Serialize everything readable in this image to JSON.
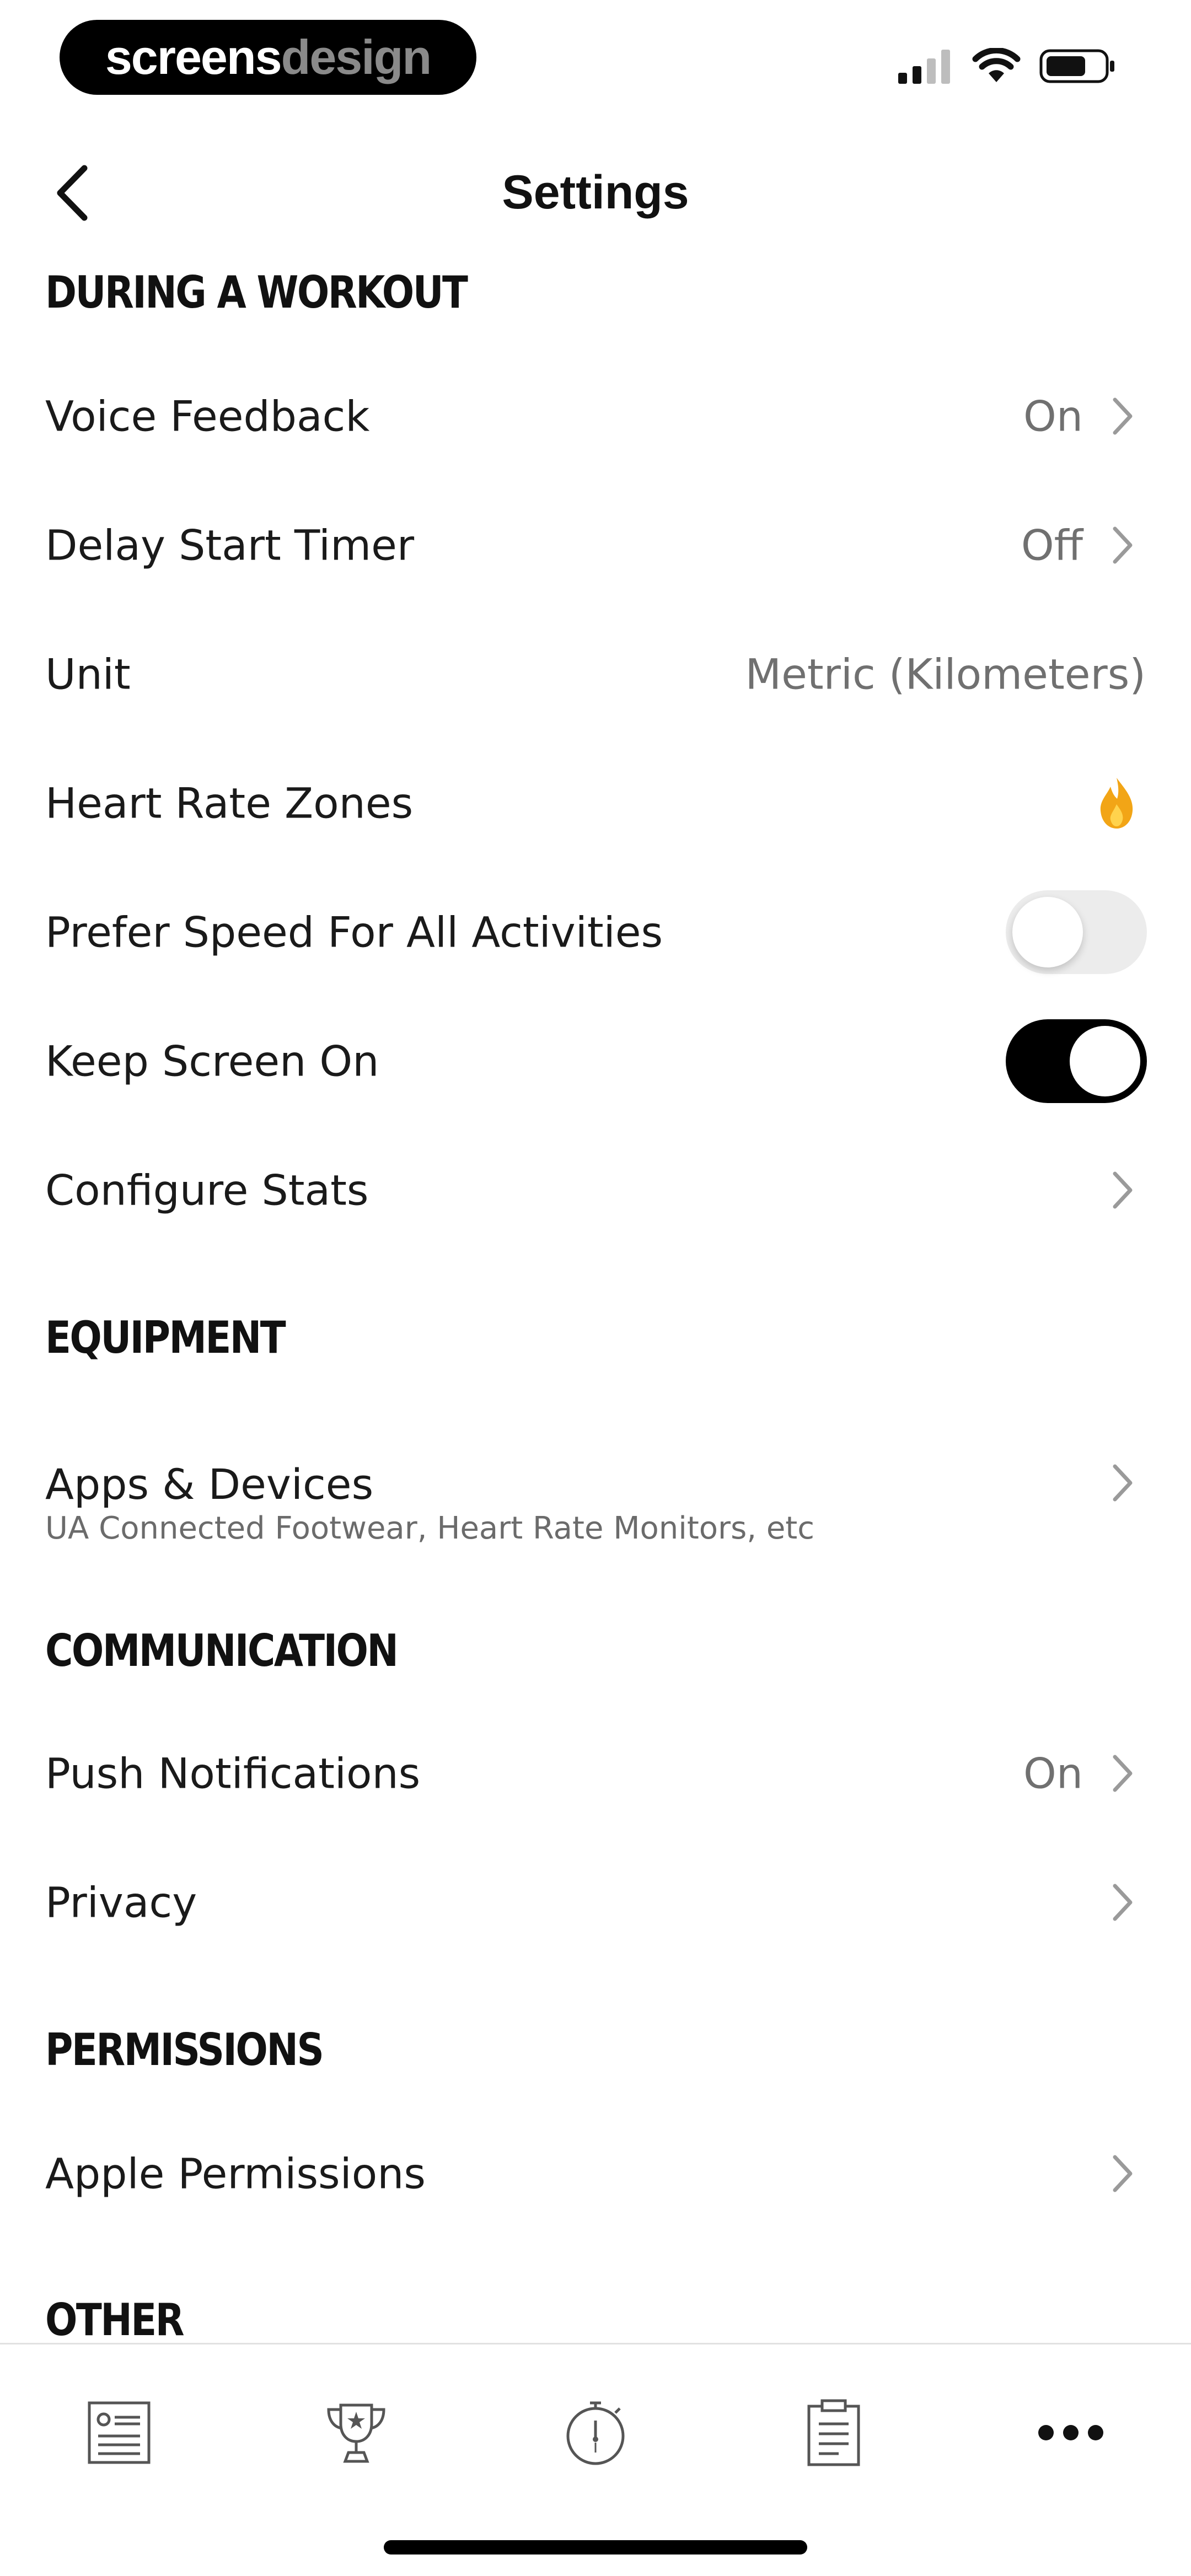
{
  "status_bar": {
    "brand_part1": "screens",
    "brand_part2": "design"
  },
  "nav": {
    "title": "Settings"
  },
  "sections": {
    "workout": "DURING A WORKOUT",
    "equipment": "EQUIPMENT",
    "communication": "COMMUNICATION",
    "permissions": "PERMISSIONS",
    "other": "OTHER"
  },
  "rows": {
    "voice_feedback": {
      "label": "Voice Feedback",
      "value": "On"
    },
    "delay_start": {
      "label": "Delay Start Timer",
      "value": "Off"
    },
    "unit": {
      "label": "Unit",
      "value": "Metric (Kilometers)"
    },
    "heart_rate_zones": {
      "label": "Heart Rate Zones"
    },
    "prefer_speed": {
      "label": "Prefer Speed For All Activities",
      "enabled": false
    },
    "keep_screen_on": {
      "label": "Keep Screen On",
      "enabled": true
    },
    "configure_stats": {
      "label": "Configure Stats"
    },
    "apps_devices": {
      "label": "Apps & Devices",
      "sublabel": "UA Connected Footwear, Heart Rate Monitors, etc"
    },
    "push_notifications": {
      "label": "Push Notifications",
      "value": "On"
    },
    "privacy": {
      "label": "Privacy"
    },
    "apple_permissions": {
      "label": "Apple Permissions"
    }
  },
  "tab_bar": {
    "items": [
      "feed-icon",
      "trophy-icon",
      "stopwatch-icon",
      "clipboard-icon",
      "more-icon"
    ]
  },
  "colors": {
    "accent": "#000000",
    "value_text": "#707070",
    "flame_orange": "#F2A516",
    "toggle_off_track": "#ECECEC"
  }
}
